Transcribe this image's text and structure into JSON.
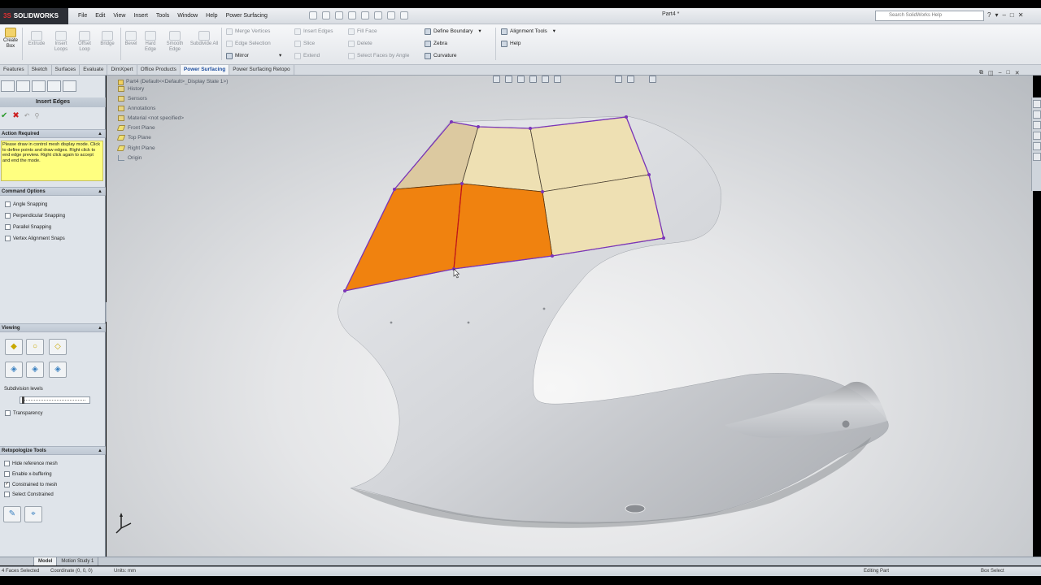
{
  "app": {
    "logo_text": "SOLIDWORKS",
    "document_title": "Part4 *",
    "menu": [
      "File",
      "Edit",
      "View",
      "Insert",
      "Tools",
      "Window",
      "Help",
      "Power Surfacing"
    ],
    "search_placeholder": "Search SolidWorks Help",
    "window_controls": [
      "?",
      "▾",
      "–",
      "□",
      "✕"
    ]
  },
  "command_manager": {
    "create_box": "Create Box",
    "left_buttons": [
      "Extrude",
      "Insert Loops",
      "Offset Loop",
      "Bridge",
      "Bevel",
      "Hard Edge",
      "Smooth Edge",
      "Subdivide All"
    ],
    "col1": [
      {
        "label": "Merge Vertices",
        "active": false
      },
      {
        "label": "Edge Selection",
        "active": false
      },
      {
        "label": "Mirror",
        "active": true
      }
    ],
    "col2": [
      {
        "label": "Insert Edges",
        "active": false
      },
      {
        "label": "Slice",
        "active": false
      },
      {
        "label": "Extend",
        "active": false
      }
    ],
    "col3": [
      {
        "label": "Fill Face",
        "active": false
      },
      {
        "label": "Delete",
        "active": false
      },
      {
        "label": "Select Faces by Angle",
        "active": false
      }
    ],
    "col4": [
      {
        "label": "Define Boundary",
        "active": true
      },
      {
        "label": "Zebra",
        "active": true
      },
      {
        "label": "Curvature",
        "active": true
      }
    ],
    "col5": [
      {
        "label": "Alignment Tools",
        "active": true
      },
      {
        "label": "Help",
        "active": true
      }
    ]
  },
  "tabs": [
    "Features",
    "Sketch",
    "Surfaces",
    "Evaluate",
    "DimXpert",
    "Office Products",
    "Power Surfacing",
    "Power Surfacing Retopo"
  ],
  "active_tab": "Power Surfacing",
  "property_manager": {
    "title": "Insert Edges",
    "ok": "✔",
    "cancel": "✖",
    "action_required": {
      "header": "Action Required",
      "message": "Please draw in control mesh display mode. Click to define points and draw edges. Right click to end edge preview. Right click again to accept and end the mode."
    },
    "command_options": {
      "header": "Command Options",
      "items": [
        {
          "label": "Angle Snapping",
          "checked": false
        },
        {
          "label": "Perpendicular Snapping",
          "checked": false
        },
        {
          "label": "Parallel Snapping",
          "checked": false
        },
        {
          "label": "Vertex Alignment Snaps",
          "checked": false
        }
      ]
    },
    "viewing": {
      "header": "Viewing",
      "subdivision_label": "Subdivision levels",
      "transparency_label": "Transparency",
      "transparency_checked": false
    },
    "retopologize": {
      "header": "Retopologize Tools",
      "items": [
        {
          "label": "Hide reference mesh",
          "checked": false
        },
        {
          "label": "Enable x-buffering",
          "checked": false
        },
        {
          "label": "Constrained to mesh",
          "checked": true
        },
        {
          "label": "Select Constrained",
          "checked": false
        }
      ]
    }
  },
  "feature_tree": {
    "root": "Part4 (Default<<Default>_Display State 1>)",
    "items": [
      {
        "label": "History",
        "kind": "folder"
      },
      {
        "label": "Sensors",
        "kind": "folder"
      },
      {
        "label": "Annotations",
        "kind": "folder"
      },
      {
        "label": "Material <not specified>",
        "kind": "folder"
      },
      {
        "label": "Front Plane",
        "kind": "plane"
      },
      {
        "label": "Top Plane",
        "kind": "plane"
      },
      {
        "label": "Right Plane",
        "kind": "plane"
      },
      {
        "label": "Origin",
        "kind": "origin"
      }
    ]
  },
  "bottom_tabs": [
    "",
    "Model",
    "Motion Study 1"
  ],
  "active_bottom_tab": "Model",
  "status": {
    "selection": "4 Faces Selected",
    "coordinate": "Coordinate (0, 0, 0)",
    "units": "Units: mm",
    "editing": "Editing Part",
    "mode": "Box Select"
  },
  "colors": {
    "selected_faces": "#f0820f",
    "mesh_faces": "#e9dcae",
    "control_mesh_edge": "#7b35b8",
    "body": "#d8dade"
  }
}
